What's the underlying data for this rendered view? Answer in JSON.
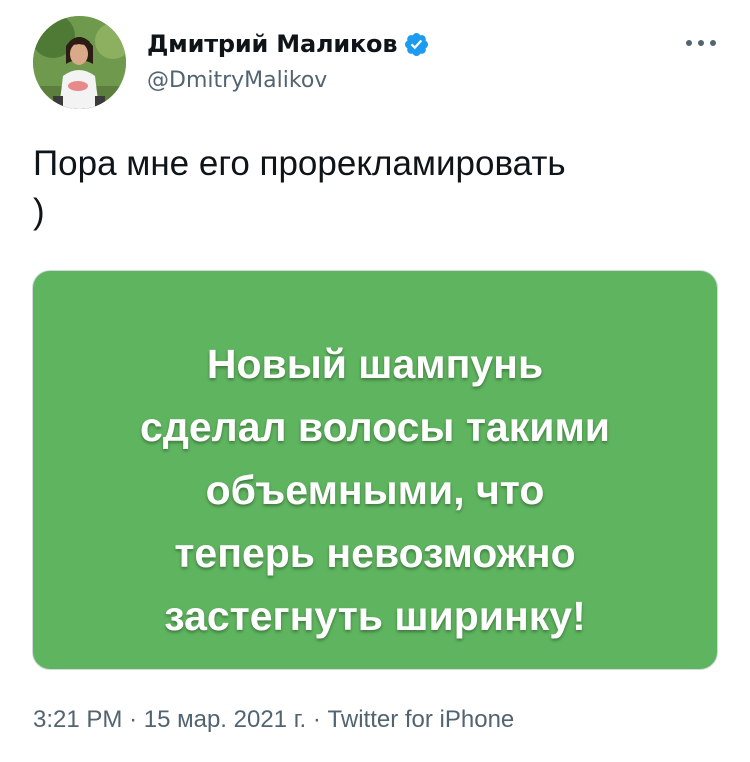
{
  "author": {
    "display_name": "Дмитрий Маликов",
    "handle": "@DmitryMalikov",
    "verified": true
  },
  "tweet": {
    "text": "Пора мне его прорекламировать\n)"
  },
  "media": {
    "background_color": "#5fb55f",
    "text": "Новый шампунь\nсделал волосы такими\nобъемными, что\nтеперь невозможно\nзастегнуть ширинку!"
  },
  "meta": {
    "time": "3:21 PM",
    "date": "15 мар. 2021 г.",
    "source": "Twitter for iPhone",
    "separator": "·"
  },
  "icons": {
    "verified": "verified-badge-icon",
    "more": "more-options-icon"
  },
  "colors": {
    "verified_blue": "#1d9bf0",
    "secondary_text": "#536471"
  }
}
